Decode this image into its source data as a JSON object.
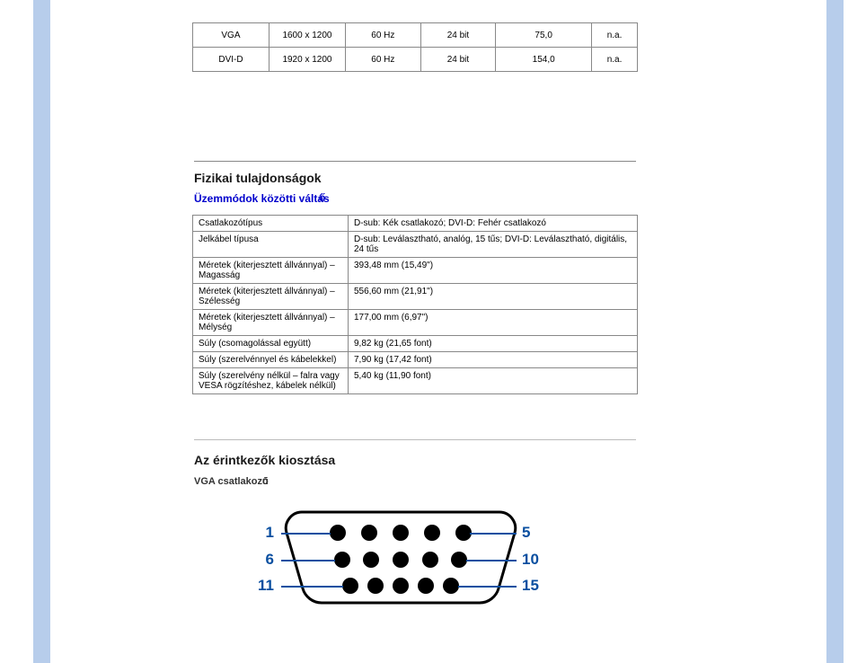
{
  "top_table": {
    "rows": [
      {
        "c1": "VGA",
        "c2": "1600 x 1200",
        "c3": "60 Hz",
        "c4": "24 bit",
        "c5": "75,0",
        "c6": "n.a."
      },
      {
        "c1": "DVI-D",
        "c2": "1920 x 1200",
        "c3": "60 Hz",
        "c4": "24 bit",
        "c5": "154,0",
        "c6": "n.a."
      }
    ]
  },
  "section": {
    "title": "Fizikai tulajdonságok",
    "subtitle": "Üzemmódok közötti váltás",
    "subtitle_accent": "ő",
    "rows": [
      {
        "k": "Csatlakozótípus",
        "v": "D-sub: Kék csatlakozó; DVI-D: Fehér csatlakozó"
      },
      {
        "k": "Jelkábel típusa",
        "v": "D-sub: Leválasztható, analóg, 15 tűs; DVI-D: Leválasztható, digitális, 24 tűs"
      },
      {
        "k": "Méretek (kiterjesztett állvánnyal) – Magasság",
        "v": "393,48 mm (15,49\")"
      },
      {
        "k": "Méretek (kiterjesztett állvánnyal) – Szélesség",
        "v": "556,60 mm (21,91\")"
      },
      {
        "k": "Méretek (kiterjesztett állvánnyal) – Mélység",
        "v": "177,00 mm (6,97\")"
      },
      {
        "k": "Súly (csomagolással együtt)",
        "v": "9,82 kg (21,65 font)"
      },
      {
        "k": "Súly (szerelvénnyel és kábelekkel)",
        "v": "7,90 kg (17,42 font)"
      },
      {
        "k": "Súly (szerelvény nélkül – falra vagy VESA rögzítéshez, kábelek nélkül)",
        "v": "5,40 kg (11,90 font)"
      }
    ]
  },
  "connectors": {
    "title": "Az érintkezők kiosztása",
    "sub": "VGA csatlakozó",
    "sub_accent": "ű",
    "labels": {
      "l1": "1",
      "l5": "5",
      "l6": "6",
      "l10": "10",
      "l11": "11",
      "l15": "15"
    }
  }
}
